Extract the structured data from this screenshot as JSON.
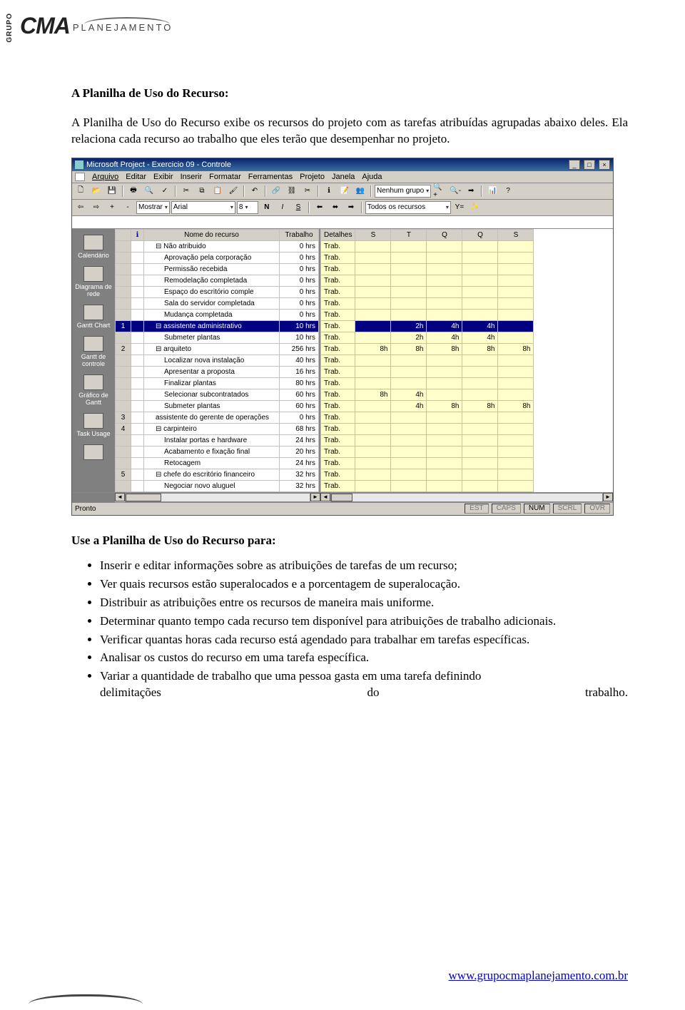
{
  "logo": {
    "grupo": "GRUPO",
    "cma": "CMA",
    "plan": "PLANEJAMENTO"
  },
  "heading": "A Planilha de Uso do Recurso:",
  "para1": "A Planilha de Uso do Recurso exibe os recursos do projeto com as tarefas atribuídas agrupadas abaixo deles. Ela relaciona cada recurso ao trabalho que eles terão que desempenhar no projeto.",
  "section2": "Use a Planilha de Uso do Recurso para:",
  "bullets": {
    "b1": "Inserir e editar informações sobre as atribuições de tarefas de um recurso;",
    "b2": "Ver quais recursos estão superalocados e a porcentagem de superalocação.",
    "b3": "Distribuir as atribuições entre os recursos de maneira mais uniforme.",
    "b4": "Determinar quanto tempo cada recurso tem disponível para atribuições de trabalho adicionais.",
    "b5": "Verificar quantas horas cada recurso está agendado para trabalhar em tarefas específicas.",
    "b6": "Analisar os custos do recurso em uma tarefa específica.",
    "b7": "Variar a quantidade de trabalho que uma pessoa gasta em uma tarefa definindo",
    "b7a": "delimitações",
    "b7b": "do",
    "b7c": "trabalho."
  },
  "footer": {
    "url": "www.grupocmaplanejamento.com.br"
  },
  "app": {
    "title": "Microsoft Project - Exercicio 09 - Controle",
    "menus": {
      "m0": "Arquivo",
      "m1": "Editar",
      "m2": "Exibir",
      "m3": "Inserir",
      "m4": "Formatar",
      "m5": "Ferramentas",
      "m6": "Projeto",
      "m7": "Janela",
      "m8": "Ajuda"
    },
    "combo_group": "Nenhum grupo",
    "combo_show": "Mostrar",
    "font_name": "Arial",
    "font_size": "8",
    "filter": "Todos os recursos",
    "viewbar": {
      "v0": "Calendário",
      "v1": "Diagrama de rede",
      "v2": "Gantt Chart",
      "v3": "Gantt de controle",
      "v4": "Gráfico de Gantt",
      "v5": "Task Usage"
    },
    "cols": {
      "name": "Nome do recurso",
      "work": "Trabalho",
      "det": "Detalhes"
    },
    "days": {
      "d0": "S",
      "d1": "T",
      "d2": "Q",
      "d3": "Q",
      "d4": "S"
    },
    "trab": "Trab.",
    "rows": [
      {
        "id": "",
        "name": "Não atribuido",
        "work": "0 hrs",
        "lvl": 1,
        "sel": false,
        "exp": "⊟"
      },
      {
        "id": "",
        "name": "Aprovação pela corporação",
        "work": "0 hrs",
        "lvl": 2
      },
      {
        "id": "",
        "name": "Permissão recebida",
        "work": "0 hrs",
        "lvl": 2
      },
      {
        "id": "",
        "name": "Remodelação completada",
        "work": "0 hrs",
        "lvl": 2
      },
      {
        "id": "",
        "name": "Espaço do escritório comple",
        "work": "0 hrs",
        "lvl": 2
      },
      {
        "id": "",
        "name": "Sala do servidor completada",
        "work": "0 hrs",
        "lvl": 2
      },
      {
        "id": "",
        "name": "Mudança completada",
        "work": "0 hrs",
        "lvl": 2
      },
      {
        "id": "1",
        "name": "assistente administrativo",
        "work": "10 hrs",
        "lvl": 1,
        "sel": true,
        "exp": "⊟",
        "cells": [
          "",
          "2h",
          "4h",
          "4h",
          ""
        ]
      },
      {
        "id": "",
        "name": "Submeter plantas",
        "work": "10 hrs",
        "lvl": 2,
        "cells": [
          "",
          "2h",
          "4h",
          "4h",
          ""
        ]
      },
      {
        "id": "2",
        "name": "arquiteto",
        "work": "256 hrs",
        "lvl": 1,
        "exp": "⊟",
        "cells": [
          "8h",
          "8h",
          "8h",
          "8h",
          "8h"
        ]
      },
      {
        "id": "",
        "name": "Localizar nova instalação",
        "work": "40 hrs",
        "lvl": 2
      },
      {
        "id": "",
        "name": "Apresentar a proposta",
        "work": "16 hrs",
        "lvl": 2
      },
      {
        "id": "",
        "name": "Finalizar plantas",
        "work": "80 hrs",
        "lvl": 2
      },
      {
        "id": "",
        "name": "Selecionar subcontratados",
        "work": "60 hrs",
        "lvl": 2,
        "cells": [
          "8h",
          "4h",
          "",
          "",
          ""
        ]
      },
      {
        "id": "",
        "name": "Submeter plantas",
        "work": "60 hrs",
        "lvl": 2,
        "cells": [
          "",
          "4h",
          "8h",
          "8h",
          "8h"
        ]
      },
      {
        "id": "3",
        "name": "assistente do gerente de operações",
        "work": "0 hrs",
        "lvl": 1
      },
      {
        "id": "4",
        "name": "carpinteiro",
        "work": "68 hrs",
        "lvl": 1,
        "exp": "⊟"
      },
      {
        "id": "",
        "name": "Instalar portas e hardware",
        "work": "24 hrs",
        "lvl": 2
      },
      {
        "id": "",
        "name": "Acabamento e fixação final",
        "work": "20 hrs",
        "lvl": 2
      },
      {
        "id": "",
        "name": "Retocagem",
        "work": "24 hrs",
        "lvl": 2
      },
      {
        "id": "5",
        "name": "chefe do escritório financeiro",
        "work": "32 hrs",
        "lvl": 1,
        "exp": "⊟"
      },
      {
        "id": "",
        "name": "Negociar novo aluguel",
        "work": "32 hrs",
        "lvl": 2
      }
    ],
    "status": {
      "ready": "Pronto",
      "est": "EST",
      "caps": "CAPS",
      "num": "NUM",
      "scrl": "SCRL",
      "ovr": "OVR"
    }
  }
}
